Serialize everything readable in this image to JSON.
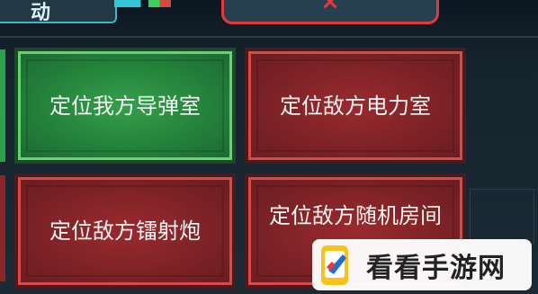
{
  "header": {
    "left_label": "动",
    "close_symbol": "×"
  },
  "buttons": [
    {
      "label": "定位我方导弹室",
      "state": "selected",
      "color": "#2f9a45"
    },
    {
      "label": "定位敌方电力室",
      "state": "normal",
      "color": "#8a2529"
    },
    {
      "label": "定位敌方镭射炮",
      "state": "normal",
      "color": "#8a2529"
    },
    {
      "label": "定位敌方随机房间",
      "state": "normal",
      "color": "#8a2529"
    }
  ],
  "watermark": {
    "text": "看看手游网"
  },
  "colors": {
    "accent": "#3fb6c8",
    "close_red": "#e23a3a",
    "green_border": "#63d46f",
    "red_border": "#d84a48"
  }
}
